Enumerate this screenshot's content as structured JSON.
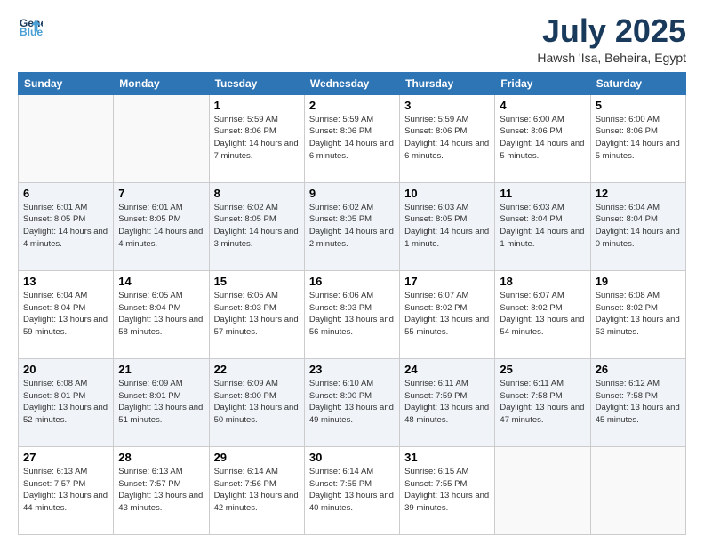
{
  "header": {
    "logo_line1": "General",
    "logo_line2": "Blue",
    "month": "July 2025",
    "location": "Hawsh 'Isa, Beheira, Egypt"
  },
  "days_of_week": [
    "Sunday",
    "Monday",
    "Tuesday",
    "Wednesday",
    "Thursday",
    "Friday",
    "Saturday"
  ],
  "weeks": [
    [
      {
        "day": "",
        "info": ""
      },
      {
        "day": "",
        "info": ""
      },
      {
        "day": "1",
        "info": "Sunrise: 5:59 AM\nSunset: 8:06 PM\nDaylight: 14 hours and 7 minutes."
      },
      {
        "day": "2",
        "info": "Sunrise: 5:59 AM\nSunset: 8:06 PM\nDaylight: 14 hours and 6 minutes."
      },
      {
        "day": "3",
        "info": "Sunrise: 5:59 AM\nSunset: 8:06 PM\nDaylight: 14 hours and 6 minutes."
      },
      {
        "day": "4",
        "info": "Sunrise: 6:00 AM\nSunset: 8:06 PM\nDaylight: 14 hours and 5 minutes."
      },
      {
        "day": "5",
        "info": "Sunrise: 6:00 AM\nSunset: 8:06 PM\nDaylight: 14 hours and 5 minutes."
      }
    ],
    [
      {
        "day": "6",
        "info": "Sunrise: 6:01 AM\nSunset: 8:05 PM\nDaylight: 14 hours and 4 minutes."
      },
      {
        "day": "7",
        "info": "Sunrise: 6:01 AM\nSunset: 8:05 PM\nDaylight: 14 hours and 4 minutes."
      },
      {
        "day": "8",
        "info": "Sunrise: 6:02 AM\nSunset: 8:05 PM\nDaylight: 14 hours and 3 minutes."
      },
      {
        "day": "9",
        "info": "Sunrise: 6:02 AM\nSunset: 8:05 PM\nDaylight: 14 hours and 2 minutes."
      },
      {
        "day": "10",
        "info": "Sunrise: 6:03 AM\nSunset: 8:05 PM\nDaylight: 14 hours and 1 minute."
      },
      {
        "day": "11",
        "info": "Sunrise: 6:03 AM\nSunset: 8:04 PM\nDaylight: 14 hours and 1 minute."
      },
      {
        "day": "12",
        "info": "Sunrise: 6:04 AM\nSunset: 8:04 PM\nDaylight: 14 hours and 0 minutes."
      }
    ],
    [
      {
        "day": "13",
        "info": "Sunrise: 6:04 AM\nSunset: 8:04 PM\nDaylight: 13 hours and 59 minutes."
      },
      {
        "day": "14",
        "info": "Sunrise: 6:05 AM\nSunset: 8:04 PM\nDaylight: 13 hours and 58 minutes."
      },
      {
        "day": "15",
        "info": "Sunrise: 6:05 AM\nSunset: 8:03 PM\nDaylight: 13 hours and 57 minutes."
      },
      {
        "day": "16",
        "info": "Sunrise: 6:06 AM\nSunset: 8:03 PM\nDaylight: 13 hours and 56 minutes."
      },
      {
        "day": "17",
        "info": "Sunrise: 6:07 AM\nSunset: 8:02 PM\nDaylight: 13 hours and 55 minutes."
      },
      {
        "day": "18",
        "info": "Sunrise: 6:07 AM\nSunset: 8:02 PM\nDaylight: 13 hours and 54 minutes."
      },
      {
        "day": "19",
        "info": "Sunrise: 6:08 AM\nSunset: 8:02 PM\nDaylight: 13 hours and 53 minutes."
      }
    ],
    [
      {
        "day": "20",
        "info": "Sunrise: 6:08 AM\nSunset: 8:01 PM\nDaylight: 13 hours and 52 minutes."
      },
      {
        "day": "21",
        "info": "Sunrise: 6:09 AM\nSunset: 8:01 PM\nDaylight: 13 hours and 51 minutes."
      },
      {
        "day": "22",
        "info": "Sunrise: 6:09 AM\nSunset: 8:00 PM\nDaylight: 13 hours and 50 minutes."
      },
      {
        "day": "23",
        "info": "Sunrise: 6:10 AM\nSunset: 8:00 PM\nDaylight: 13 hours and 49 minutes."
      },
      {
        "day": "24",
        "info": "Sunrise: 6:11 AM\nSunset: 7:59 PM\nDaylight: 13 hours and 48 minutes."
      },
      {
        "day": "25",
        "info": "Sunrise: 6:11 AM\nSunset: 7:58 PM\nDaylight: 13 hours and 47 minutes."
      },
      {
        "day": "26",
        "info": "Sunrise: 6:12 AM\nSunset: 7:58 PM\nDaylight: 13 hours and 45 minutes."
      }
    ],
    [
      {
        "day": "27",
        "info": "Sunrise: 6:13 AM\nSunset: 7:57 PM\nDaylight: 13 hours and 44 minutes."
      },
      {
        "day": "28",
        "info": "Sunrise: 6:13 AM\nSunset: 7:57 PM\nDaylight: 13 hours and 43 minutes."
      },
      {
        "day": "29",
        "info": "Sunrise: 6:14 AM\nSunset: 7:56 PM\nDaylight: 13 hours and 42 minutes."
      },
      {
        "day": "30",
        "info": "Sunrise: 6:14 AM\nSunset: 7:55 PM\nDaylight: 13 hours and 40 minutes."
      },
      {
        "day": "31",
        "info": "Sunrise: 6:15 AM\nSunset: 7:55 PM\nDaylight: 13 hours and 39 minutes."
      },
      {
        "day": "",
        "info": ""
      },
      {
        "day": "",
        "info": ""
      }
    ]
  ]
}
